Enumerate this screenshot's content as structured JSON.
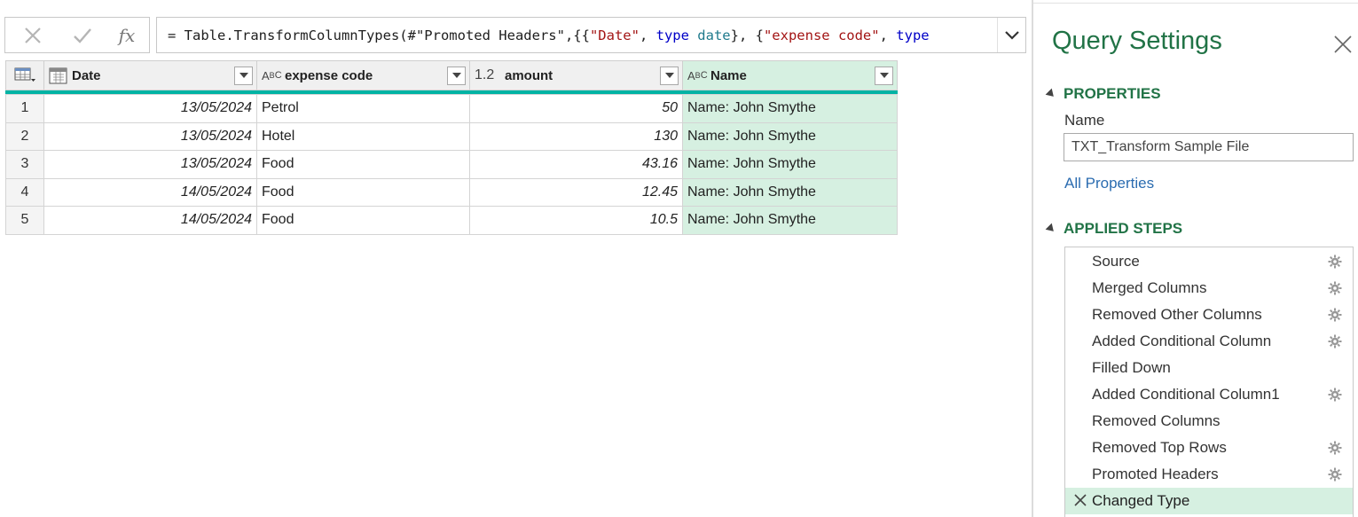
{
  "formula_bar": {
    "fx_label": "fx",
    "parts": [
      {
        "text": "= Table.TransformColumnTypes(#",
        "kind": "plain"
      },
      {
        "text": "\"Promoted Headers\"",
        "kind": "plain"
      },
      {
        "text": ",{{",
        "kind": "plain"
      },
      {
        "text": "\"Date\"",
        "kind": "str"
      },
      {
        "text": ", ",
        "kind": "plain"
      },
      {
        "text": "type",
        "kind": "kw"
      },
      {
        "text": " ",
        "kind": "plain"
      },
      {
        "text": "date",
        "kind": "ty"
      },
      {
        "text": "}, {",
        "kind": "plain"
      },
      {
        "text": "\"expense code\"",
        "kind": "str"
      },
      {
        "text": ", ",
        "kind": "plain"
      },
      {
        "text": "type",
        "kind": "kw"
      }
    ]
  },
  "table": {
    "columns": [
      {
        "label": "Date",
        "type_icon": "date-type-icon"
      },
      {
        "label": "expense code",
        "type_icon": "ABC"
      },
      {
        "label": "amount",
        "type_icon": "1.2"
      },
      {
        "label": "Name",
        "type_icon": "ABC"
      }
    ],
    "rows": [
      {
        "n": "1",
        "date": "13/05/2024",
        "code": "Petrol",
        "amount": "50",
        "name": "Name: John Smythe"
      },
      {
        "n": "2",
        "date": "13/05/2024",
        "code": "Hotel",
        "amount": "130",
        "name": "Name: John Smythe"
      },
      {
        "n": "3",
        "date": "13/05/2024",
        "code": "Food",
        "amount": "43.16",
        "name": "Name: John Smythe"
      },
      {
        "n": "4",
        "date": "14/05/2024",
        "code": "Food",
        "amount": "12.45",
        "name": "Name: John Smythe"
      },
      {
        "n": "5",
        "date": "14/05/2024",
        "code": "Food",
        "amount": "10.5",
        "name": "Name: John Smythe"
      }
    ]
  },
  "query_settings": {
    "title": "Query Settings",
    "properties_heading": "PROPERTIES",
    "name_label": "Name",
    "name_value": "TXT_Transform Sample File",
    "all_properties_link": "All Properties",
    "applied_steps_heading": "APPLIED STEPS",
    "steps": [
      {
        "label": "Source",
        "gear": true
      },
      {
        "label": "Merged Columns",
        "gear": true
      },
      {
        "label": "Removed Other Columns",
        "gear": true
      },
      {
        "label": "Added Conditional Column",
        "gear": true
      },
      {
        "label": "Filled Down",
        "gear": false
      },
      {
        "label": "Added Conditional Column1",
        "gear": true
      },
      {
        "label": "Removed Columns",
        "gear": false
      },
      {
        "label": "Removed Top Rows",
        "gear": true
      },
      {
        "label": "Promoted Headers",
        "gear": true
      },
      {
        "label": "Changed Type",
        "gear": false,
        "active": true
      }
    ]
  },
  "colors": {
    "accent_green": "#217346",
    "selected_column": "#d6f0e1",
    "header_underline": "#00b3a4",
    "link_blue": "#2b6cb0"
  }
}
